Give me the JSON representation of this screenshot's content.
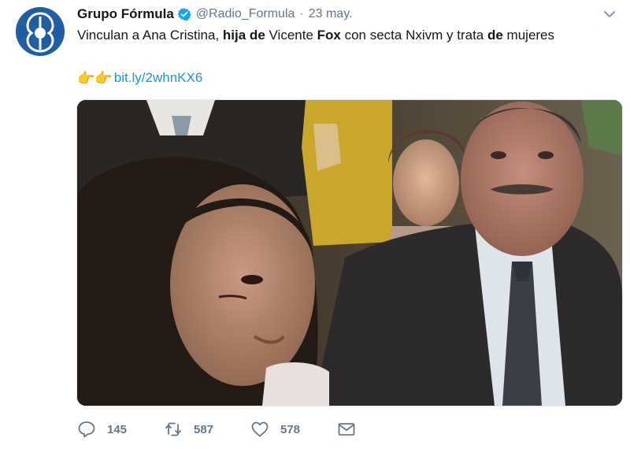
{
  "author": {
    "display_name": "Grupo Fórmula",
    "handle": "@Radio_Formula",
    "separator": "·",
    "time": "23 may.",
    "avatar_icon": "grupo-formula-logo-icon",
    "verified_icon": "verified-badge-icon"
  },
  "tweet": {
    "text_parts": [
      "Vinculan a Ana Cristina, ",
      "hija de",
      " Vicente ",
      "Fox",
      " con secta Nxivm y trata ",
      "de",
      " mujeres"
    ],
    "emoji": "👉👉",
    "link": "bit.ly/2whnKX6"
  },
  "media": {
    "description_icon": "photo-image"
  },
  "actions": {
    "reply_count": "145",
    "retweet_count": "587",
    "like_count": "578",
    "reply_icon": "reply-icon",
    "retweet_icon": "retweet-icon",
    "like_icon": "heart-icon",
    "dm_icon": "envelope-icon"
  },
  "colors": {
    "link": "#1b95e0",
    "muted": "#657786",
    "brand_blue": "#1e5fa6"
  }
}
